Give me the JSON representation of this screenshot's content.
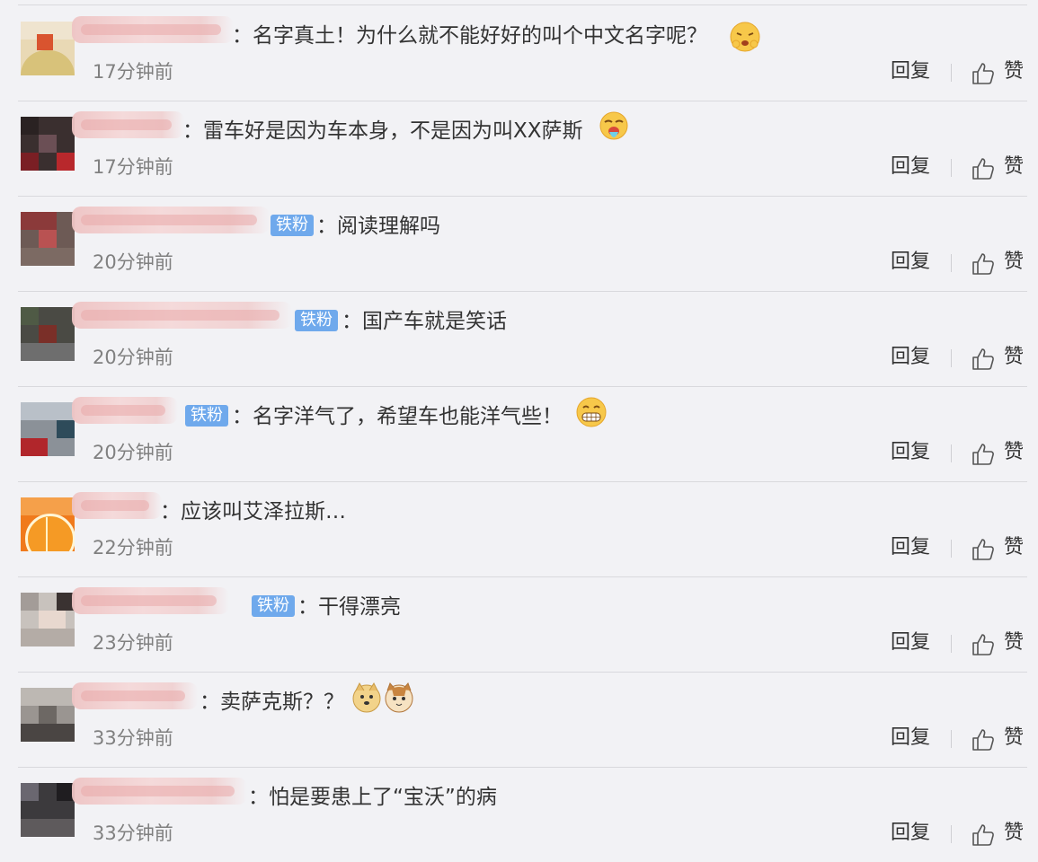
{
  "labels": {
    "reply": "回复",
    "like": "赞",
    "badge": "铁粉"
  },
  "comments": [
    {
      "text": "：名字真土！为什么就不能好好的叫个中文名字呢？",
      "time": "17分钟前",
      "badge": false,
      "emoji": "shy-laugh-emoji"
    },
    {
      "text": "：雷车好是因为车本身，不是因为叫XX萨斯",
      "time": "17分钟前",
      "badge": false,
      "emoji": "vomit-emoji"
    },
    {
      "text": "：阅读理解吗",
      "time": "20分钟前",
      "badge": true,
      "emoji": ""
    },
    {
      "text": "：国产车就是笑话",
      "time": "20分钟前",
      "badge": true,
      "emoji": ""
    },
    {
      "text": "：名字洋气了，希望车也能洋气些！",
      "time": "20分钟前",
      "badge": true,
      "emoji": "grin-emoji"
    },
    {
      "text": "：应该叫艾泽拉斯…",
      "time": "22分钟前",
      "badge": false,
      "emoji": ""
    },
    {
      "text": "：干得漂亮",
      "time": "23分钟前",
      "badge": true,
      "emoji": ""
    },
    {
      "text": "：卖萨克斯？？",
      "time": "33分钟前",
      "badge": false,
      "emoji": "doge-and-cat-emoji"
    },
    {
      "text": "：怕是要患上了“宝沃”的病",
      "time": "33分钟前",
      "badge": false,
      "emoji": ""
    }
  ],
  "colors": {
    "badge": "#6fa9ec",
    "username": "#eb7350",
    "text": "#333333",
    "time": "#808080",
    "background": "#f2f2f5"
  }
}
